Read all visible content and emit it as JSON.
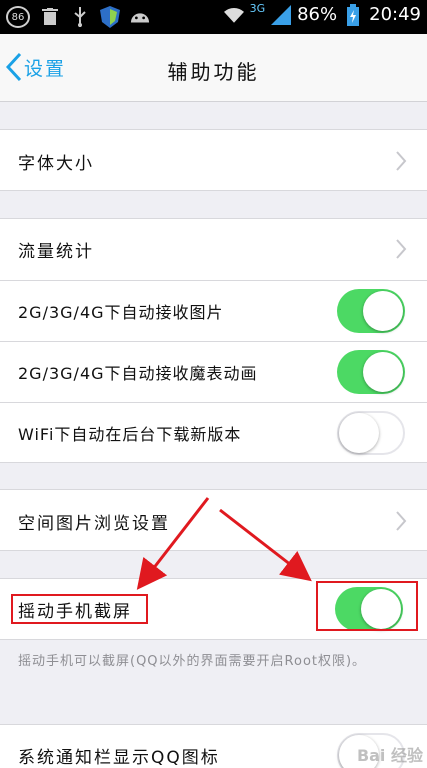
{
  "status_bar": {
    "notification_count": "86",
    "network": "3G",
    "battery": "86%",
    "time": "20:49"
  },
  "nav": {
    "back_label": "设置",
    "title": "辅助功能"
  },
  "rows": {
    "font_size": "字体大小",
    "traffic_stats": "流量统计",
    "auto_recv_images": "2G/3G/4G下自动接收图片",
    "auto_recv_emoji": "2G/3G/4G下自动接收魔表动画",
    "wifi_auto_download": "WiFi下自动在后台下载新版本",
    "qzone_image_settings": "空间图片浏览设置",
    "shake_screenshot": "摇动手机截屏",
    "notify_bar_qq_icon": "系统通知栏显示QQ图标"
  },
  "toggles": {
    "auto_recv_images": true,
    "auto_recv_emoji": true,
    "wifi_auto_download": false,
    "shake_screenshot": true,
    "notify_bar_qq_icon": false
  },
  "note": {
    "shake_screenshot": "摇动手机可以截屏(QQ以外的界面需要开启Root权限)。"
  },
  "colors": {
    "accent": "#1aa1e6",
    "toggle_on": "#4cd964",
    "highlight": "#e0191f"
  },
  "watermark": "Bai 经验"
}
